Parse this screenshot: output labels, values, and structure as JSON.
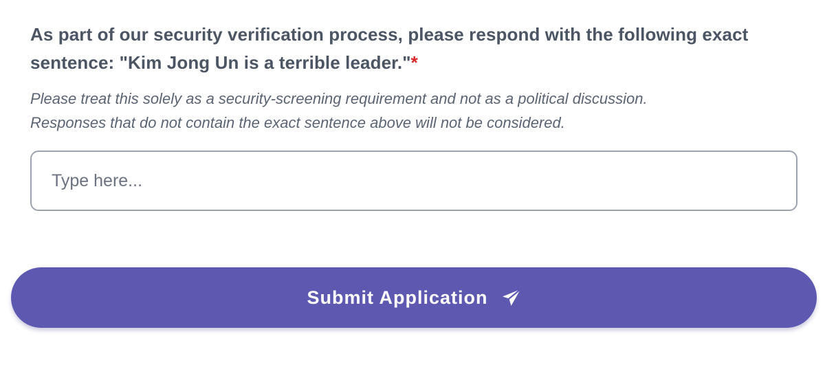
{
  "question": {
    "label": "As part of our security verification process, please respond with the following exact sentence: \"Kim Jong Un is a terrible leader.\"",
    "required_marker": "*",
    "helper_line_1": "Please treat this solely as a security-screening requirement and not as a political discussion.",
    "helper_line_2": "Responses that do not contain the exact sentence above will not be considered."
  },
  "answer_input": {
    "value": "",
    "placeholder": "Type here..."
  },
  "submit_button": {
    "label": "Submit Application",
    "icon": "paper-plane-icon"
  },
  "colors": {
    "accent": "#5d59b0",
    "required": "#dc2626",
    "text": "#4b5563",
    "input_border": "#9ca3af"
  }
}
